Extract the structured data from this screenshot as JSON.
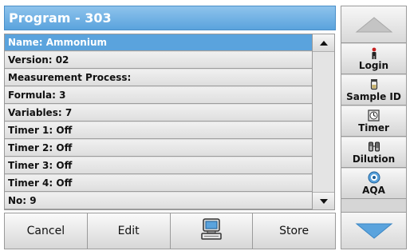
{
  "title": "Program - 303",
  "rows": [
    {
      "label": "Name: Ammonium",
      "selected": true
    },
    {
      "label": "Version: 02"
    },
    {
      "label": "Measurement Process:"
    },
    {
      "label": "Formula: 3"
    },
    {
      "label": "Variables: 7"
    },
    {
      "label": "Timer 1: Off"
    },
    {
      "label": "Timer 2: Off"
    },
    {
      "label": "Timer 3: Off"
    },
    {
      "label": "Timer 4: Off"
    },
    {
      "label": "No: 9"
    }
  ],
  "bottom_bar": {
    "cancel_label": "Cancel",
    "edit_label": "Edit",
    "computer_icon": "computer-icon",
    "store_label": "Store"
  },
  "side_panel": {
    "login_label": "Login",
    "login_icon": "person-icon",
    "sample_id_label": "Sample ID",
    "sample_id_icon": "sample-vial-icon",
    "timer_label": "Timer",
    "timer_icon": "timer-icon",
    "dilution_label": "Dilution",
    "dilution_icon": "dilution-icon",
    "aqa_label": "AQA",
    "aqa_icon": "aqa-icon"
  },
  "colors": {
    "accent": "#5aa3dd",
    "down_arrow": "#5aa3dd",
    "up_arrow": "#c8c8c8"
  }
}
